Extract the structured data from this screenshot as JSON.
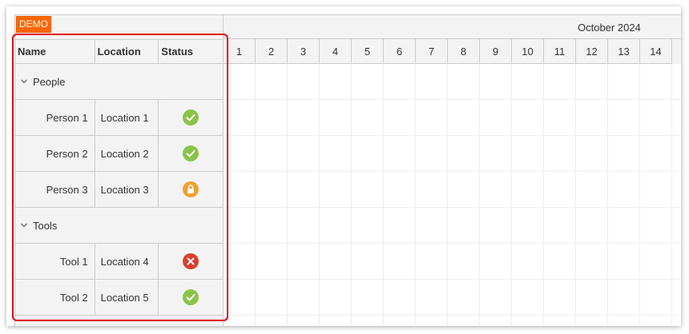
{
  "badge": "DEMO",
  "columns": [
    "Name",
    "Location",
    "Status"
  ],
  "month": "October 2024",
  "days": [
    "1",
    "2",
    "3",
    "4",
    "5",
    "6",
    "7",
    "8",
    "9",
    "10",
    "11",
    "12",
    "13",
    "14"
  ],
  "rows": [
    {
      "type": "group",
      "label": "People"
    },
    {
      "type": "resource",
      "name": "Person 1",
      "location": "Location 1",
      "status": "ok"
    },
    {
      "type": "resource",
      "name": "Person 2",
      "location": "Location 2",
      "status": "ok"
    },
    {
      "type": "resource",
      "name": "Person 3",
      "location": "Location 3",
      "status": "locked"
    },
    {
      "type": "group",
      "label": "Tools"
    },
    {
      "type": "resource",
      "name": "Tool 1",
      "location": "Location 4",
      "status": "error"
    },
    {
      "type": "resource",
      "name": "Tool 2",
      "location": "Location 5",
      "status": "ok"
    }
  ],
  "status_icons": {
    "ok": {
      "icon": "checkmark-icon",
      "color": "#8bc34a"
    },
    "locked": {
      "icon": "lock-icon",
      "color": "#f0a030"
    },
    "error": {
      "icon": "close-icon",
      "color": "#d8402d"
    }
  },
  "colors": {
    "badge": "#ff6600",
    "highlight": "#e60000",
    "header_bg": "#f3f3f3",
    "border": "#cccccc"
  }
}
